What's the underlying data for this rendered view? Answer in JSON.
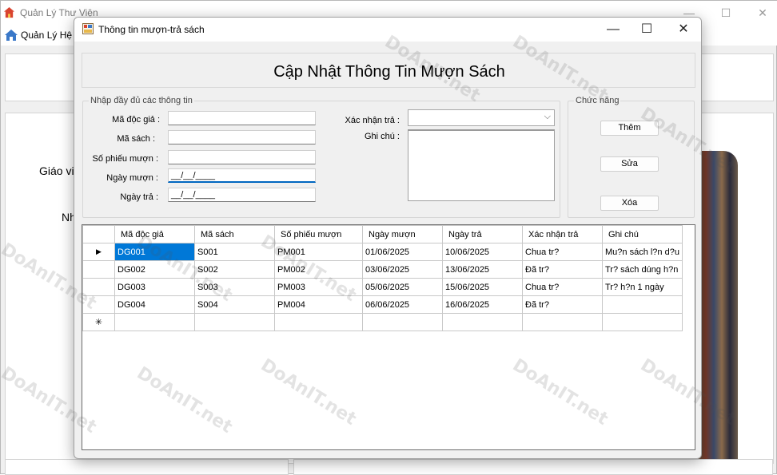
{
  "background_window": {
    "title": "Quản Lý Thư Viện",
    "menu_label": "Quản Lý Hệ T",
    "label_gv": "Giáo vi",
    "label_nh": "Nh"
  },
  "dialog": {
    "title": "Thông tin mượn-trả sách",
    "header": "Cập Nhật Thông Tin Mượn Sách",
    "input_group_legend": "Nhập đầy đủ các thông tin",
    "function_group_legend": "Chức năng",
    "fields": {
      "ma_doc_gia_label": "Mã độc giả :",
      "ma_sach_label": "Mã sách :",
      "so_phieu_muon_label": "Số phiếu mượn :",
      "ngay_muon_label": "Ngày mượn :",
      "ngay_muon_value": "__/__/____",
      "ngay_tra_label": "Ngày trả :",
      "ngay_tra_value": "__/__/____",
      "xac_nhan_tra_label": "Xác nhận trả :",
      "ghi_chu_label": "Ghi chú :"
    },
    "buttons": {
      "add": "Thêm",
      "edit": "Sửa",
      "delete": "Xóa"
    }
  },
  "grid": {
    "columns": [
      "Mã độc giả",
      "Mã sách",
      "Số phiếu mượn",
      "Ngày mượn",
      "Ngày trả",
      "Xác nhận trả",
      "Ghi chú"
    ],
    "rows": [
      [
        "DG001",
        "S001",
        "PM001",
        "01/06/2025",
        "10/06/2025",
        "Chua tr?",
        "Mu?n sách l?n d?u"
      ],
      [
        "DG002",
        "S002",
        "PM002",
        "03/06/2025",
        "13/06/2025",
        "Đã tr?",
        "Tr? sách dúng h?n"
      ],
      [
        "DG003",
        "S003",
        "PM003",
        "05/06/2025",
        "15/06/2025",
        "Chua tr?",
        "Tr? h?n 1 ngày"
      ],
      [
        "DG004",
        "S004",
        "PM004",
        "06/06/2025",
        "16/06/2025",
        "Đã tr?",
        ""
      ]
    ],
    "current_row_marker": "▶",
    "new_row_marker": "✳"
  },
  "watermark_text": "DoAnIT.net",
  "colors": {
    "selection": "#0078d7",
    "focus_underline": "#0067c0"
  }
}
